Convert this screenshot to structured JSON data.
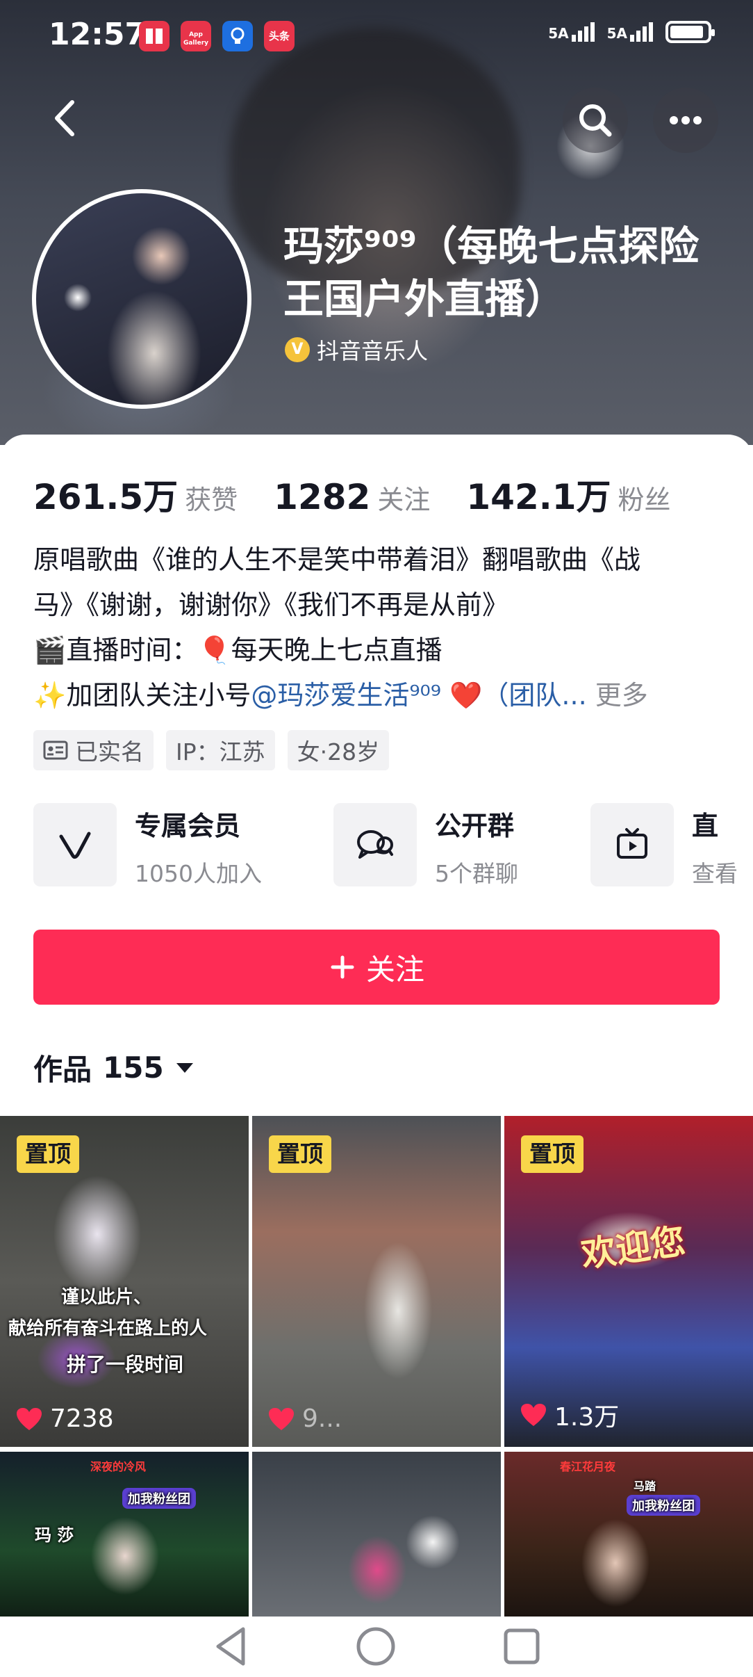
{
  "status_bar": {
    "time": "12:57",
    "apps": [
      {
        "label": "",
        "color": "#e8344a"
      },
      {
        "label": "App Gallery",
        "color": "#e8344a"
      },
      {
        "label": "",
        "color": "#1e6fe0"
      },
      {
        "label": "头条",
        "color": "#e8344a"
      }
    ],
    "signal_1": "5A",
    "signal_2": "5A",
    "battery_level": 0.9
  },
  "header": {
    "nickname": "玛莎⁹⁰⁹（每晚七点探险王国户外直播）",
    "verified_label": "抖音音乐人",
    "verified_mark": "V"
  },
  "stats": [
    {
      "value": "261.5万",
      "label": "获赞"
    },
    {
      "value": "1282",
      "label": "关注"
    },
    {
      "value": "142.1万",
      "label": "粉丝"
    }
  ],
  "bio": {
    "line1": "原唱歌曲《谁的人生不是笑中带着泪》翻唱歌曲《战",
    "line2": "马》《谢谢，谢谢你》《我们不再是从前》",
    "line3": "🎬直播时间：🎈每天晚上七点直播",
    "line4_prefix": "✨加团队关注小号",
    "line4_mention": "@玛莎爱生活⁹⁰⁹",
    "line4_suffix": " ❤️（团队...",
    "more": "更多"
  },
  "tags": [
    {
      "label": "已实名",
      "icon": "id-card-icon"
    },
    {
      "label": "IP：江苏"
    },
    {
      "label": "女·28岁"
    }
  ],
  "entries": [
    {
      "title": "专属会员",
      "sub": "1050人加入",
      "icon": "vip-v-icon"
    },
    {
      "title": "公开群",
      "sub": "5个群聊",
      "icon": "group-chat-icon"
    },
    {
      "title": "直",
      "sub": "查看",
      "icon": "tv-icon"
    }
  ],
  "follow_button": {
    "label": "关注",
    "icon": "plus-icon"
  },
  "works_tab": {
    "label": "作品",
    "count": "155"
  },
  "videos": [
    {
      "pinned": "置顶",
      "likes": "7238",
      "caption1": "谨以此片、",
      "caption2": "献给所有奋斗在路上的人",
      "caption3": "拼了一段时间"
    },
    {
      "pinned": "置顶",
      "likes": "9..."
    },
    {
      "pinned": "置顶",
      "likes": "1.3万",
      "banner": "欢迎您"
    },
    {
      "top_text": "深夜的冷风",
      "badge": "加我粉丝团",
      "name_text": "玛 莎"
    },
    {},
    {
      "top_text": "春江花月夜",
      "badge": "加我粉丝团",
      "name_text": "马踏"
    }
  ],
  "colors": {
    "accent": "#fe2c55",
    "pin": "#f8d64a",
    "mention": "#2a5ea6",
    "verify": "#f5c33b"
  }
}
